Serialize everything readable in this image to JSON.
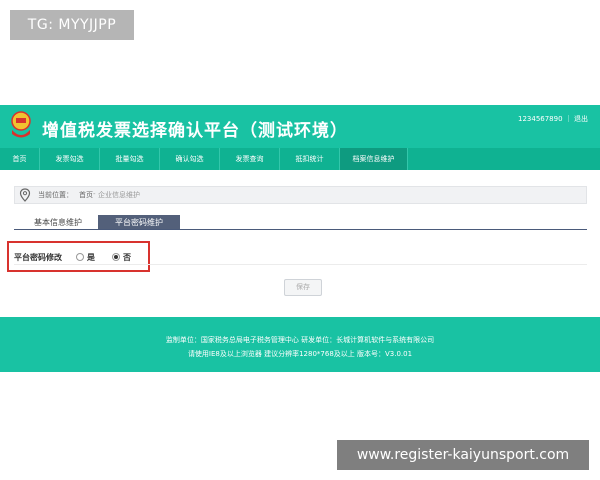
{
  "watermark_top": "TG: MYYJJPP",
  "watermark_bottom": "www.register-kaiyunsport.com",
  "header": {
    "title": "增值税发票选择确认平台（测试环境）",
    "user_id": "1234567890 ｜ 退出"
  },
  "nav": {
    "items": [
      {
        "label": "首页"
      },
      {
        "label": "发票勾选"
      },
      {
        "label": "批量勾选"
      },
      {
        "label": "确认勾选"
      },
      {
        "label": "发票查询"
      },
      {
        "label": "抵扣统计"
      },
      {
        "label": "档案信息维护"
      }
    ]
  },
  "breadcrumb": {
    "label": "当前位置：",
    "home": "首页",
    "separator": "-",
    "current": "企业信息维护"
  },
  "tabs": {
    "basic": "基本信息维护",
    "password": "平台密码维护"
  },
  "form": {
    "field_label": "平台密码修改",
    "option_yes": "是",
    "option_no": "否",
    "selected": "否",
    "save_label": "保存"
  },
  "footer": {
    "line1": "监制单位：国家税务总局电子税务管理中心    研发单位：长城计算机软件与系统有限公司",
    "line2": "请使用IE8及以上浏览器    建议分辨率1280*768及以上    版本号：V3.0.01"
  },
  "colors": {
    "brand": "#19c2a3",
    "nav": "#0fb292",
    "tab_active": "#53607a",
    "highlight": "#d8322e"
  }
}
